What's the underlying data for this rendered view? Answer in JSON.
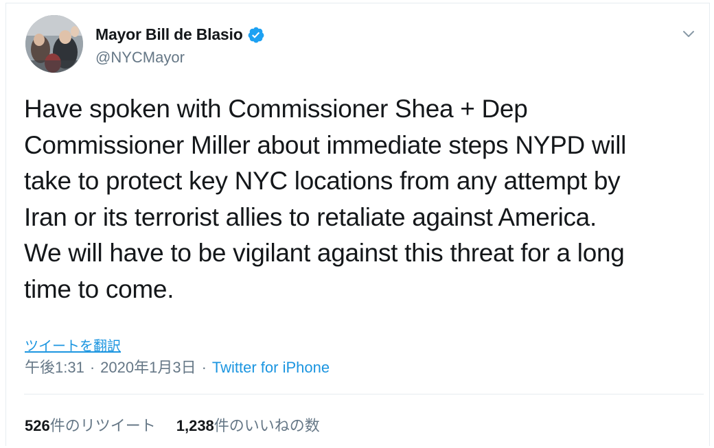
{
  "author": {
    "display_name": "Mayor Bill de Blasio",
    "handle": "@NYCMayor",
    "verified": true
  },
  "tweet": {
    "text": "Have spoken with Commissioner Shea + Dep\nCommissioner Miller about immediate steps NYPD will\ntake to protect key NYC locations from any attempt by\nIran or its terrorist allies to retaliate against America.\nWe will have to be vigilant against this threat for a long\ntime to come.",
    "translate_label": "ツイートを翻訳",
    "time": "午後1:31",
    "separator": "·",
    "date": "2020年1月3日",
    "source": "Twitter for iPhone"
  },
  "stats": {
    "retweets_count": "526",
    "retweets_label": "件のリツイート",
    "likes_count": "1,238",
    "likes_label": "件のいいねの数"
  },
  "colors": {
    "link": "#1b95e0",
    "text": "#14171a",
    "secondary": "#657786",
    "border": "#e6ecf0",
    "verified": "#1da1f2"
  },
  "icons": {
    "verified": "verified-badge-icon",
    "caret": "chevron-down-icon"
  }
}
